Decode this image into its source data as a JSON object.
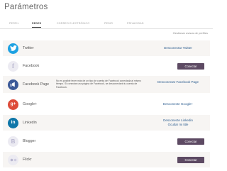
{
  "page": {
    "title": "Parámetros"
  },
  "tabs": [
    {
      "label": "PERFIL"
    },
    {
      "label": "REDES"
    },
    {
      "label": "CORREO ELECTRÓNICO"
    },
    {
      "label": "PEDIR"
    },
    {
      "label": "PRIVACIDAD"
    }
  ],
  "manage_link": "Gestionar avisos de perfiles",
  "networks": [
    {
      "name": "Twitter",
      "action": "Desconectar Twitter",
      "icon": "twitter-icon",
      "color": "#1da1e2"
    },
    {
      "name": "Facebook",
      "action": "Conectar",
      "icon": "facebook-icon",
      "color": "#ecebf2"
    },
    {
      "name": "Facebook Page",
      "note": "No es posible tener más de un tipo de cuenta de Facebook conectada al mismo tiempo. Si conectas una página de Facebook, se desconectará tu cuenta de Facebook.",
      "action": "Desconectar Facebook Page",
      "icon": "facebook-page-icon",
      "color": "#3b5998"
    },
    {
      "name": "Google+",
      "action": "Desconecte Google+",
      "icon": "google-plus-icon",
      "color": "#dd4b39"
    },
    {
      "name": "Linkedin",
      "action": "Desconecte Linkedin",
      "action2": "Ocultar mi title",
      "icon": "linkedin-icon",
      "color": "#0e76a8"
    },
    {
      "name": "Blogger",
      "action": "Conectar",
      "icon": "blogger-icon",
      "color": "#ecebf2"
    },
    {
      "name": "Flickr",
      "action": "Conectar",
      "icon": "flickr-icon",
      "color": "#ecebf2"
    }
  ]
}
